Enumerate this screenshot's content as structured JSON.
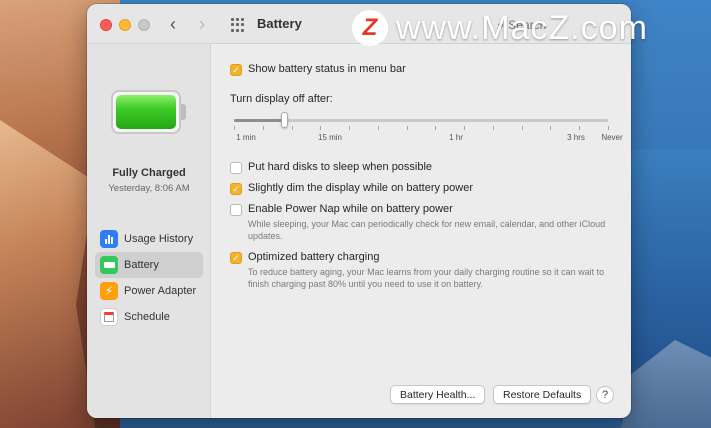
{
  "watermark": {
    "logo": "Z",
    "text": "www.MacZ.com"
  },
  "window": {
    "title": "Battery"
  },
  "search": {
    "placeholder": "Search"
  },
  "status": {
    "title": "Fully Charged",
    "subtitle": "Yesterday, 8:06 AM",
    "level_percent": 100
  },
  "sidebar": {
    "items": [
      {
        "label": "Usage History",
        "icon": "usage-history-icon",
        "active": false
      },
      {
        "label": "Battery",
        "icon": "battery-icon",
        "active": true
      },
      {
        "label": "Power Adapter",
        "icon": "power-adapter-icon",
        "active": false
      },
      {
        "label": "Schedule",
        "icon": "schedule-icon",
        "active": false
      }
    ]
  },
  "options": {
    "show_status": {
      "label": "Show battery status in menu bar",
      "checked": true
    },
    "display_off": {
      "label": "Turn display off after:",
      "ticks": [
        "1 min",
        "15 min",
        "1 hr",
        "3 hrs",
        "Never"
      ],
      "value_label": "5 min"
    },
    "hard_disks": {
      "label": "Put hard disks to sleep when possible",
      "checked": false
    },
    "dim_display": {
      "label": "Slightly dim the display while on battery power",
      "checked": true
    },
    "power_nap": {
      "label": "Enable Power Nap while on battery power",
      "checked": false,
      "description": "While sleeping, your Mac can periodically check for new email, calendar, and other iCloud updates."
    },
    "optimized": {
      "label": "Optimized battery charging",
      "checked": true,
      "description": "To reduce battery aging, your Mac learns from your daily charging routine so it can wait to finish charging past 80% until you need to use it on battery."
    }
  },
  "buttons": {
    "battery_health": "Battery Health...",
    "restore_defaults": "Restore Defaults",
    "help": "?"
  },
  "colors": {
    "accent": "#f5b32a",
    "battery_green": "#3ecb27"
  }
}
